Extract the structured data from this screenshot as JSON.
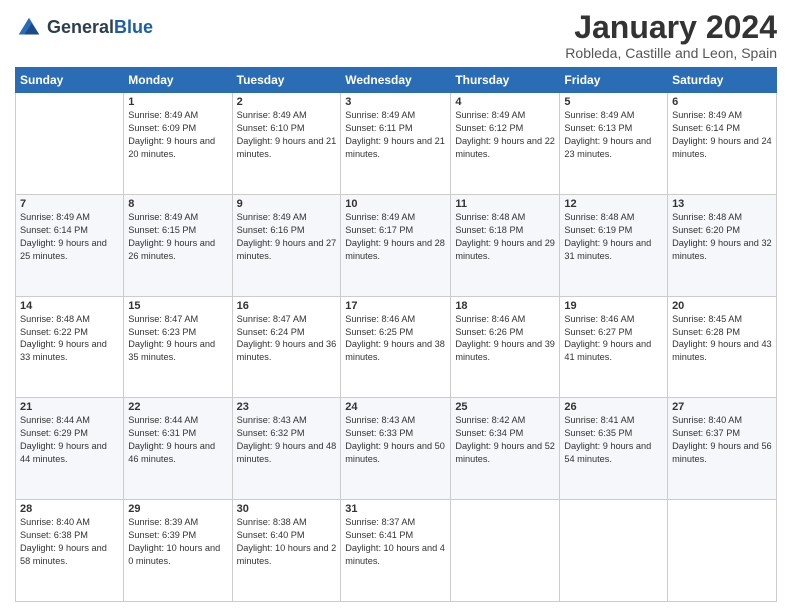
{
  "header": {
    "logo_line1": "General",
    "logo_line2": "Blue",
    "month": "January 2024",
    "location": "Robleda, Castille and Leon, Spain"
  },
  "weekdays": [
    "Sunday",
    "Monday",
    "Tuesday",
    "Wednesday",
    "Thursday",
    "Friday",
    "Saturday"
  ],
  "weeks": [
    [
      {
        "day": "",
        "sunrise": "",
        "sunset": "",
        "daylight": ""
      },
      {
        "day": "1",
        "sunrise": "Sunrise: 8:49 AM",
        "sunset": "Sunset: 6:09 PM",
        "daylight": "Daylight: 9 hours and 20 minutes."
      },
      {
        "day": "2",
        "sunrise": "Sunrise: 8:49 AM",
        "sunset": "Sunset: 6:10 PM",
        "daylight": "Daylight: 9 hours and 21 minutes."
      },
      {
        "day": "3",
        "sunrise": "Sunrise: 8:49 AM",
        "sunset": "Sunset: 6:11 PM",
        "daylight": "Daylight: 9 hours and 21 minutes."
      },
      {
        "day": "4",
        "sunrise": "Sunrise: 8:49 AM",
        "sunset": "Sunset: 6:12 PM",
        "daylight": "Daylight: 9 hours and 22 minutes."
      },
      {
        "day": "5",
        "sunrise": "Sunrise: 8:49 AM",
        "sunset": "Sunset: 6:13 PM",
        "daylight": "Daylight: 9 hours and 23 minutes."
      },
      {
        "day": "6",
        "sunrise": "Sunrise: 8:49 AM",
        "sunset": "Sunset: 6:14 PM",
        "daylight": "Daylight: 9 hours and 24 minutes."
      }
    ],
    [
      {
        "day": "7",
        "sunrise": "Sunrise: 8:49 AM",
        "sunset": "Sunset: 6:14 PM",
        "daylight": "Daylight: 9 hours and 25 minutes."
      },
      {
        "day": "8",
        "sunrise": "Sunrise: 8:49 AM",
        "sunset": "Sunset: 6:15 PM",
        "daylight": "Daylight: 9 hours and 26 minutes."
      },
      {
        "day": "9",
        "sunrise": "Sunrise: 8:49 AM",
        "sunset": "Sunset: 6:16 PM",
        "daylight": "Daylight: 9 hours and 27 minutes."
      },
      {
        "day": "10",
        "sunrise": "Sunrise: 8:49 AM",
        "sunset": "Sunset: 6:17 PM",
        "daylight": "Daylight: 9 hours and 28 minutes."
      },
      {
        "day": "11",
        "sunrise": "Sunrise: 8:48 AM",
        "sunset": "Sunset: 6:18 PM",
        "daylight": "Daylight: 9 hours and 29 minutes."
      },
      {
        "day": "12",
        "sunrise": "Sunrise: 8:48 AM",
        "sunset": "Sunset: 6:19 PM",
        "daylight": "Daylight: 9 hours and 31 minutes."
      },
      {
        "day": "13",
        "sunrise": "Sunrise: 8:48 AM",
        "sunset": "Sunset: 6:20 PM",
        "daylight": "Daylight: 9 hours and 32 minutes."
      }
    ],
    [
      {
        "day": "14",
        "sunrise": "Sunrise: 8:48 AM",
        "sunset": "Sunset: 6:22 PM",
        "daylight": "Daylight: 9 hours and 33 minutes."
      },
      {
        "day": "15",
        "sunrise": "Sunrise: 8:47 AM",
        "sunset": "Sunset: 6:23 PM",
        "daylight": "Daylight: 9 hours and 35 minutes."
      },
      {
        "day": "16",
        "sunrise": "Sunrise: 8:47 AM",
        "sunset": "Sunset: 6:24 PM",
        "daylight": "Daylight: 9 hours and 36 minutes."
      },
      {
        "day": "17",
        "sunrise": "Sunrise: 8:46 AM",
        "sunset": "Sunset: 6:25 PM",
        "daylight": "Daylight: 9 hours and 38 minutes."
      },
      {
        "day": "18",
        "sunrise": "Sunrise: 8:46 AM",
        "sunset": "Sunset: 6:26 PM",
        "daylight": "Daylight: 9 hours and 39 minutes."
      },
      {
        "day": "19",
        "sunrise": "Sunrise: 8:46 AM",
        "sunset": "Sunset: 6:27 PM",
        "daylight": "Daylight: 9 hours and 41 minutes."
      },
      {
        "day": "20",
        "sunrise": "Sunrise: 8:45 AM",
        "sunset": "Sunset: 6:28 PM",
        "daylight": "Daylight: 9 hours and 43 minutes."
      }
    ],
    [
      {
        "day": "21",
        "sunrise": "Sunrise: 8:44 AM",
        "sunset": "Sunset: 6:29 PM",
        "daylight": "Daylight: 9 hours and 44 minutes."
      },
      {
        "day": "22",
        "sunrise": "Sunrise: 8:44 AM",
        "sunset": "Sunset: 6:31 PM",
        "daylight": "Daylight: 9 hours and 46 minutes."
      },
      {
        "day": "23",
        "sunrise": "Sunrise: 8:43 AM",
        "sunset": "Sunset: 6:32 PM",
        "daylight": "Daylight: 9 hours and 48 minutes."
      },
      {
        "day": "24",
        "sunrise": "Sunrise: 8:43 AM",
        "sunset": "Sunset: 6:33 PM",
        "daylight": "Daylight: 9 hours and 50 minutes."
      },
      {
        "day": "25",
        "sunrise": "Sunrise: 8:42 AM",
        "sunset": "Sunset: 6:34 PM",
        "daylight": "Daylight: 9 hours and 52 minutes."
      },
      {
        "day": "26",
        "sunrise": "Sunrise: 8:41 AM",
        "sunset": "Sunset: 6:35 PM",
        "daylight": "Daylight: 9 hours and 54 minutes."
      },
      {
        "day": "27",
        "sunrise": "Sunrise: 8:40 AM",
        "sunset": "Sunset: 6:37 PM",
        "daylight": "Daylight: 9 hours and 56 minutes."
      }
    ],
    [
      {
        "day": "28",
        "sunrise": "Sunrise: 8:40 AM",
        "sunset": "Sunset: 6:38 PM",
        "daylight": "Daylight: 9 hours and 58 minutes."
      },
      {
        "day": "29",
        "sunrise": "Sunrise: 8:39 AM",
        "sunset": "Sunset: 6:39 PM",
        "daylight": "Daylight: 10 hours and 0 minutes."
      },
      {
        "day": "30",
        "sunrise": "Sunrise: 8:38 AM",
        "sunset": "Sunset: 6:40 PM",
        "daylight": "Daylight: 10 hours and 2 minutes."
      },
      {
        "day": "31",
        "sunrise": "Sunrise: 8:37 AM",
        "sunset": "Sunset: 6:41 PM",
        "daylight": "Daylight: 10 hours and 4 minutes."
      },
      {
        "day": "",
        "sunrise": "",
        "sunset": "",
        "daylight": ""
      },
      {
        "day": "",
        "sunrise": "",
        "sunset": "",
        "daylight": ""
      },
      {
        "day": "",
        "sunrise": "",
        "sunset": "",
        "daylight": ""
      }
    ]
  ]
}
